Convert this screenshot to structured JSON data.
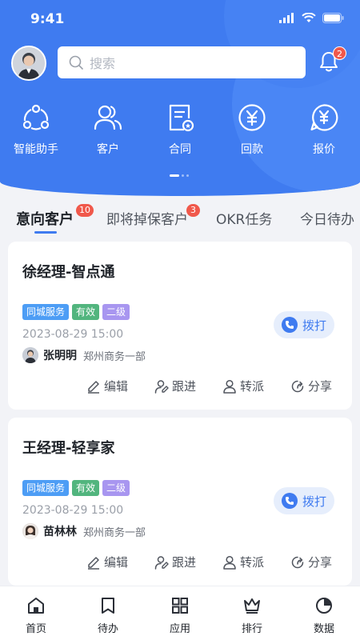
{
  "status_bar": {
    "time": "9:41"
  },
  "header": {
    "search_placeholder": "搜索",
    "notification_count": "2"
  },
  "quick_actions": [
    {
      "label": "智能助手",
      "icon": "assistant-icon"
    },
    {
      "label": "客户",
      "icon": "customers-icon"
    },
    {
      "label": "合同",
      "icon": "contract-icon"
    },
    {
      "label": "回款",
      "icon": "payment-icon"
    },
    {
      "label": "报价",
      "icon": "quote-icon"
    }
  ],
  "tabs": [
    {
      "label": "意向客户",
      "badge": "10"
    },
    {
      "label": "即将掉保客户",
      "badge": "3"
    },
    {
      "label": "OKR任务"
    },
    {
      "label": "今日待办"
    }
  ],
  "cards": [
    {
      "title": "徐经理-智点通",
      "tags": [
        {
          "text": "同城服务",
          "color": "#4d9df5"
        },
        {
          "text": "有效",
          "color": "#52b57e"
        },
        {
          "text": "二级",
          "color": "#a896f0"
        }
      ],
      "date": "2023-08-29 15:00",
      "person": "张明明",
      "dept": "郑州商务一部",
      "call_label": "拨打"
    },
    {
      "title": "王经理-轻享家",
      "tags": [
        {
          "text": "同城服务",
          "color": "#4d9df5"
        },
        {
          "text": "有效",
          "color": "#52b57e"
        },
        {
          "text": "二级",
          "color": "#a896f0"
        }
      ],
      "date": "2023-08-29 15:00",
      "person": "苗林林",
      "dept": "郑州商务一部",
      "call_label": "拨打"
    }
  ],
  "card_actions": {
    "edit": "编辑",
    "follow": "跟进",
    "transfer": "转派",
    "share": "分享"
  },
  "bottom_nav": [
    {
      "label": "首页",
      "icon": "home-icon"
    },
    {
      "label": "待办",
      "icon": "todo-icon"
    },
    {
      "label": "应用",
      "icon": "apps-icon"
    },
    {
      "label": "排行",
      "icon": "ranking-icon"
    },
    {
      "label": "数据",
      "icon": "data-icon"
    }
  ],
  "colors": {
    "primary": "#3f7bf0",
    "badge": "#f0584b"
  }
}
